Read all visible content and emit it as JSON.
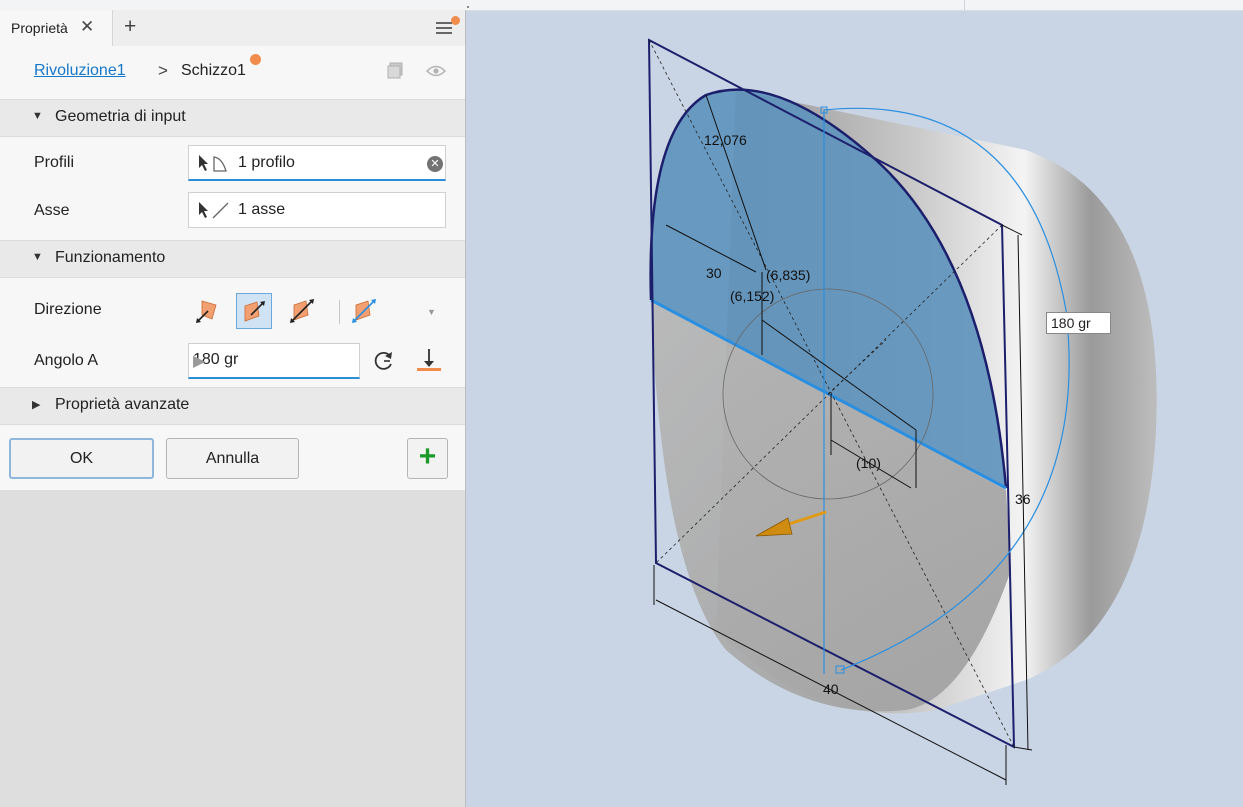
{
  "panel": {
    "tab_label": "Proprietà",
    "tab_close": "✕",
    "tab_add": "+",
    "breadcrumb": {
      "feature": "Rivoluzione1",
      "separator": ">",
      "sketch": "Schizzo1"
    },
    "sections": {
      "input_geometry": "Geometria di input",
      "behavior": "Funzionamento",
      "advanced": "Proprietà avanzate"
    },
    "profiles": {
      "label": "Profili",
      "value": "1 profilo"
    },
    "axis": {
      "label": "Asse",
      "value": "1 asse"
    },
    "direction": {
      "label": "Direzione",
      "icons": [
        "direction-default-icon",
        "direction-flip-icon",
        "direction-symmetric-icon",
        "direction-asymmetric-icon"
      ],
      "selected_index": 1
    },
    "angle": {
      "label": "Angolo A",
      "value": "180 gr"
    },
    "buttons": {
      "ok": "OK",
      "cancel": "Annulla",
      "add": "+"
    }
  },
  "viewport": {
    "dimensions": {
      "d_12076": "12,076",
      "d_30": "30",
      "d_6835": "(6,835)",
      "d_6152": "(6,152)",
      "d_10": "(10)",
      "d_36": "36",
      "d_40": "40"
    },
    "angle_tag": "180 gr"
  },
  "colors": {
    "accent": "#1678c9",
    "notification": "#f08c4c",
    "profile_fill": "#5f94bd",
    "sketch_line": "#1c1f6b",
    "preview_arc": "#2a8fe0",
    "direction_arrow": "#e09a14",
    "add_green": "#1b9a2b"
  }
}
